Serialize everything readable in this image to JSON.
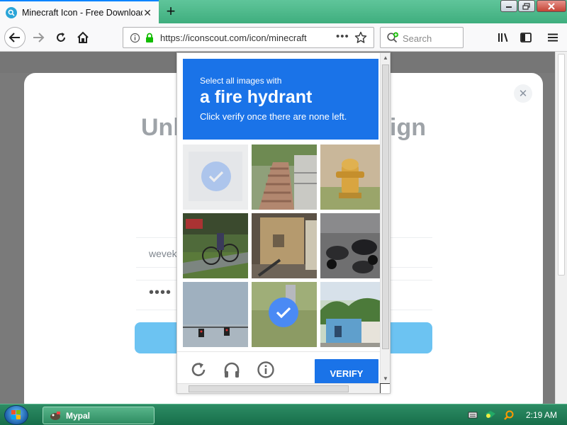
{
  "browser": {
    "tab_title": "Minecraft Icon - Free Download",
    "url": "https://iconscout.com/icon/minecraft",
    "url_more": "•••",
    "search_placeholder": "Search"
  },
  "modal": {
    "heading_left": "Unl",
    "heading_right": "ign",
    "email_value": "wevek",
    "password_value": "••••"
  },
  "captcha": {
    "instruction_line1": "Select all images with",
    "instruction_object": "a fire hydrant",
    "instruction_line3": "Click verify once there are none left.",
    "verify_label": "VERIFY",
    "accent_color": "#1a73e8",
    "tiles": [
      {
        "subject": "faded image",
        "selected": true
      },
      {
        "subject": "stairs",
        "selected": false
      },
      {
        "subject": "fire hydrant",
        "selected": false
      },
      {
        "subject": "cyclist",
        "selected": false
      },
      {
        "subject": "shed",
        "selected": false
      },
      {
        "subject": "motorcycles",
        "selected": false
      },
      {
        "subject": "traffic lights",
        "selected": false
      },
      {
        "subject": "grass",
        "selected": true
      },
      {
        "subject": "houses",
        "selected": false
      }
    ]
  },
  "taskbar": {
    "task_label": "Mypal",
    "clock": "2:19 AM"
  }
}
